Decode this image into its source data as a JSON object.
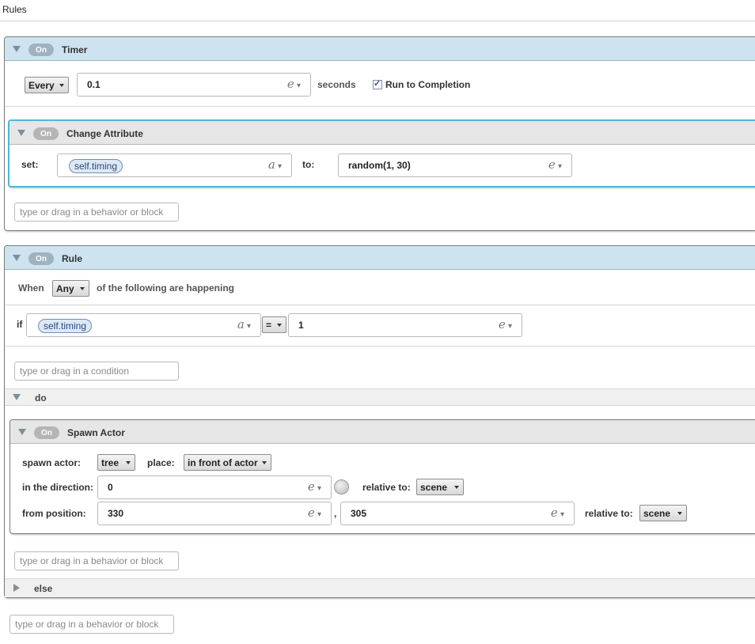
{
  "page": {
    "title": "Rules"
  },
  "timer": {
    "on_label": "On",
    "title": "Timer",
    "mode": "Every",
    "interval": "0.1",
    "unit": "seconds",
    "run_to_completion_label": "Run to Completion",
    "run_to_completion_checked": true,
    "expr_icon": "e",
    "placeholder": "type or drag in a behavior or block"
  },
  "change_attribute": {
    "on_label": "On",
    "title": "Change Attribute",
    "set_label": "set:",
    "attribute": "self.timing",
    "attr_icon": "a",
    "to_label": "to:",
    "value": "random(1, 30)",
    "expr_icon": "e"
  },
  "rule": {
    "on_label": "On",
    "title": "Rule",
    "when_label": "When",
    "match": "Any",
    "following_label": "of the following are happening",
    "if_label": "if",
    "condition_attribute": "self.timing",
    "attr_icon": "a",
    "operator": "=",
    "condition_value": "1",
    "expr_icon": "e",
    "condition_placeholder": "type or drag in a condition",
    "do_label": "do",
    "else_label": "else",
    "do_placeholder": "type or drag in a behavior or block"
  },
  "spawn_actor": {
    "on_label": "On",
    "title": "Spawn Actor",
    "spawn_label": "spawn actor:",
    "actor": "tree",
    "place_label": "place:",
    "place": "in front of actor",
    "direction_label": "in the direction:",
    "direction": "0",
    "relative_label": "relative to:",
    "direction_relative": "scene",
    "position_label": "from position:",
    "pos_x": "330",
    "comma": ",",
    "pos_y": "305",
    "position_relative": "scene",
    "expr_icon": "e"
  },
  "bottom": {
    "placeholder": "type or drag in a behavior or block"
  }
}
